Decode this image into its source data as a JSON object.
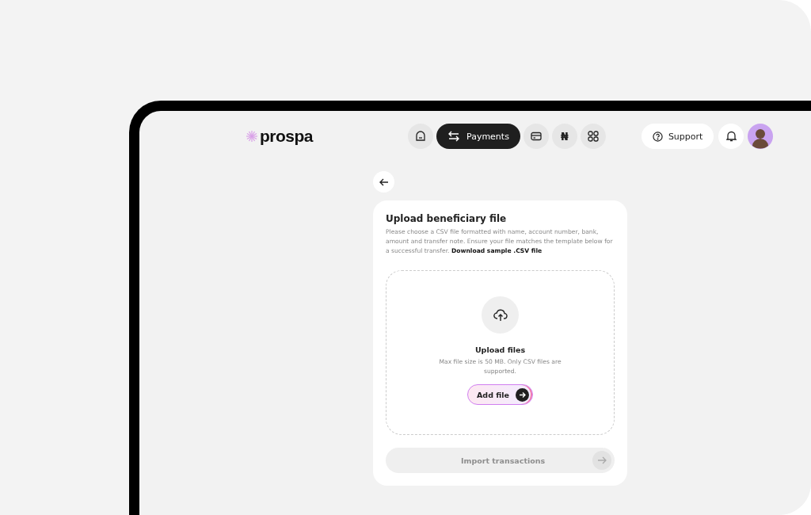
{
  "brand": {
    "name": "prospa"
  },
  "nav": [
    {
      "kind": "home",
      "selected": false
    },
    {
      "kind": "payments",
      "label": "Payments",
      "selected": true
    },
    {
      "kind": "card",
      "selected": false
    },
    {
      "kind": "currency",
      "label": "₦",
      "selected": false
    },
    {
      "kind": "apps",
      "selected": false
    }
  ],
  "support": {
    "label": "Support"
  },
  "upload": {
    "title": "Upload beneficiary file",
    "description": "Please choose a CSV file formatted with name, account number, bank, amount and transfer note. Ensure your file matches the template below for a successful transfer.",
    "download_link": "Download sample .CSV file",
    "dropzone": {
      "title": "Upload files",
      "hint": "Max file size is 50 MB. Only CSV files are supported.",
      "button": "Add file"
    },
    "submit": {
      "label": "Import transactions",
      "disabled": true
    }
  }
}
